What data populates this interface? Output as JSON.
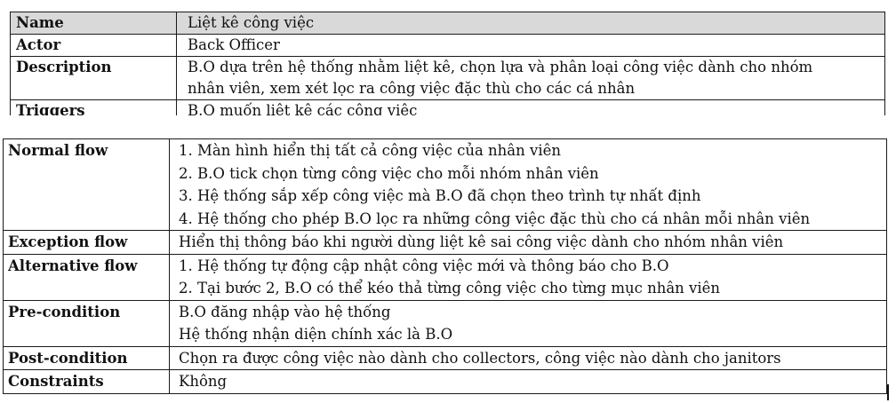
{
  "top_table": [
    {
      "label": "Name",
      "lines": [
        "Liệt kê công việc"
      ]
    },
    {
      "label": "Actor",
      "lines": [
        "Back Officer"
      ]
    },
    {
      "label": "Description",
      "lines": [
        "B.O dựa trên hệ thống nhằm liệt kê, chọn lựa và phân loại công việc dành cho nhóm",
        "nhân viên, xem xét lọc ra công việc đặc thù cho các cá nhân"
      ]
    },
    {
      "label": "Triggers",
      "lines": [
        "B.O muốn liệt kê các công việc"
      ]
    }
  ],
  "main_table": [
    {
      "label": "Normal flow",
      "lines": [
        "1. Màn hình hiển thị tất cả công việc của nhân viên",
        "2. B.O tick chọn từng công việc cho mỗi nhóm nhân viên",
        "3. Hệ thống sắp xếp công việc mà B.O đã chọn theo trình tự nhất định",
        "4. Hệ thống cho phép B.O lọc ra những công việc đặc thù cho cá nhân mỗi nhân viên"
      ]
    },
    {
      "label": "Exception flow",
      "lines": [
        "Hiển thị thông báo khi người dùng liệt kê sai công việc dành cho nhóm nhân viên"
      ]
    },
    {
      "label": "Alternative flow",
      "lines": [
        "1. Hệ thống tự động cập nhật công việc mới và thông báo cho B.O",
        "2. Tại bước 2, B.O có thể kéo thả từng công việc cho từng mục nhân viên"
      ]
    },
    {
      "label": "Pre-condition",
      "lines": [
        "B.O đăng nhập vào hệ thống",
        "Hệ thống nhận diện chính xác là B.O"
      ]
    },
    {
      "label": "Post-condition",
      "lines": [
        "Chọn ra được công việc nào dành cho collectors, công việc nào dành cho janitors"
      ]
    },
    {
      "label": "Constraints",
      "lines": [
        "Không"
      ]
    }
  ]
}
